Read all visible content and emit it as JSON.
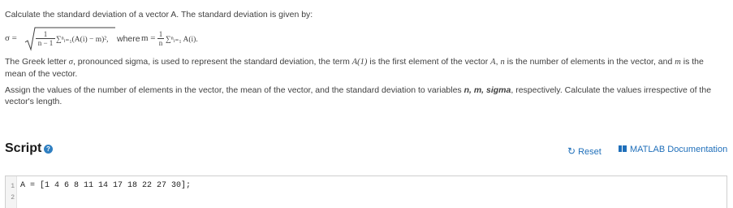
{
  "problem": {
    "intro": "Calculate the standard deviation of a vector A. The standard deviation is given by:",
    "formula": {
      "sigma_eq": "σ =",
      "one": "1",
      "n_minus_1": "n − 1",
      "sum_expr": "∑ⁿᵢ₌₁(A(i) − m)²,",
      "where": "where",
      "m_eq": "m =",
      "n": "n",
      "sum2": "∑ⁿᵢ₌₁ A(i)."
    },
    "desc_parts": [
      "The Greek letter ",
      "σ",
      ", pronounced sigma, is used to represent the standard deviation, the term ",
      "A(1)",
      " is the first element of the vector ",
      "A",
      ", ",
      "n",
      " is the number of elements in the vector, and ",
      "m",
      " is the mean of the vector."
    ],
    "assign_parts": [
      "Assign the values of the number of elements in the vector, the mean of the vector, and the standard deviation to variables ",
      "n, m, sigma",
      ", respectively. Calculate the values irrespective of the vector's length."
    ]
  },
  "script": {
    "title": "Script",
    "help_icon": "?",
    "reset_label": "Reset",
    "reset_icon": "↻",
    "doc_label": "MATLAB Documentation",
    "lines": [
      {
        "num": "1",
        "code": "A = [1 4 6 8 11 14 17 18 22 27 30];"
      },
      {
        "num": "2",
        "code": ""
      }
    ]
  }
}
